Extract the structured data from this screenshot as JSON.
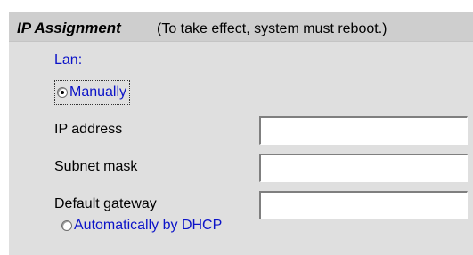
{
  "title": {
    "strong": "IP Assignment",
    "note": "(To take effect, system must reboot.)"
  },
  "lan": {
    "label": "Lan:"
  },
  "options": {
    "manual_label": "Manually",
    "dhcp_label": "Automatically by DHCP",
    "selected": "manual"
  },
  "fields": {
    "ip_address": {
      "label": "IP address",
      "value": ""
    },
    "subnet_mask": {
      "label": "Subnet mask",
      "value": ""
    },
    "default_gateway": {
      "label": "Default gateway",
      "value": ""
    }
  },
  "colors": {
    "accent_text": "#0b13c8",
    "panel_bg": "#dfdfdf",
    "title_bg": "#cecece"
  }
}
